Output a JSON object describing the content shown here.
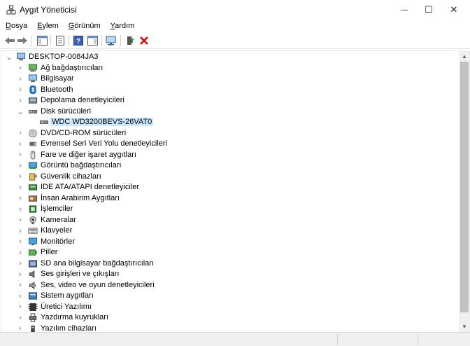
{
  "window": {
    "title": "Aygıt Yöneticisi",
    "minimize_glyph": "—",
    "maximize_glyph": "☐",
    "close_glyph": "✕"
  },
  "menu": [
    {
      "u": "D",
      "rest": "osya"
    },
    {
      "u": "E",
      "rest": "ylem"
    },
    {
      "u": "G",
      "rest": "örünüm"
    },
    {
      "u": "Y",
      "rest": "ardım"
    }
  ],
  "toolbar": {
    "buttons": [
      "back-arrow-icon",
      "forward-arrow-icon",
      "show-hide-console-tree-icon",
      "properties-icon",
      "help-icon",
      "action-pane-icon",
      "scan-hardware-icon",
      "update-driver-icon",
      "uninstall-icon"
    ]
  },
  "tree": {
    "root": "DESKTOP-0084JA3",
    "items": [
      {
        "label": "Ağ bağdaştırıcıları",
        "icon": "network-adapter-icon",
        "expanded": false
      },
      {
        "label": "Bilgisayar",
        "icon": "computer-icon",
        "expanded": false
      },
      {
        "label": "Bluetooth",
        "icon": "bluetooth-icon",
        "expanded": false
      },
      {
        "label": "Depolama denetleyicileri",
        "icon": "storage-controller-icon",
        "expanded": false
      },
      {
        "label": "Disk sürücüleri",
        "icon": "disk-drive-icon",
        "expanded": true
      },
      {
        "label": "WDC WD3200BEVS-26VAT0",
        "icon": "disk-drive-icon",
        "child": true,
        "selected": true
      },
      {
        "label": "DVD/CD-ROM sürücüleri",
        "icon": "dvd-drive-icon",
        "expanded": false
      },
      {
        "label": "Evrensel Seri Veri Yolu denetleyicileri",
        "icon": "usb-icon",
        "expanded": false
      },
      {
        "label": "Fare ve diğer işaret aygıtları",
        "icon": "mouse-icon",
        "expanded": false
      },
      {
        "label": "Görüntü bağdaştırıcıları",
        "icon": "display-adapter-icon",
        "expanded": false
      },
      {
        "label": "Güvenlik cihazları",
        "icon": "security-device-icon",
        "expanded": false
      },
      {
        "label": "IDE ATA/ATAPI denetleyiciler",
        "icon": "ide-controller-icon",
        "expanded": false
      },
      {
        "label": "İnsan Arabirim Aygıtları",
        "icon": "hid-icon",
        "expanded": false
      },
      {
        "label": "İşlemciler",
        "icon": "processor-icon",
        "expanded": false
      },
      {
        "label": "Kameralar",
        "icon": "camera-icon",
        "expanded": false
      },
      {
        "label": "Klavyeler",
        "icon": "keyboard-icon",
        "expanded": false
      },
      {
        "label": "Monitörler",
        "icon": "monitor-icon",
        "expanded": false
      },
      {
        "label": "Piller",
        "icon": "battery-icon",
        "expanded": false
      },
      {
        "label": "SD ana bilgisayar bağdaştırıcıları",
        "icon": "sd-host-icon",
        "expanded": false
      },
      {
        "label": "Ses girişleri ve çıkışları",
        "icon": "speaker-icon",
        "expanded": false
      },
      {
        "label": "Ses, video ve oyun denetleyicileri",
        "icon": "sound-controller-icon",
        "expanded": false
      },
      {
        "label": "Sistem aygıtları",
        "icon": "system-device-icon",
        "expanded": false
      },
      {
        "label": "Üretici Yazılımı",
        "icon": "firmware-icon",
        "expanded": false
      },
      {
        "label": "Yazdırma kuyrukları",
        "icon": "print-queue-icon",
        "expanded": false
      },
      {
        "label": "Yazılım cihazları",
        "icon": "software-device-icon",
        "expanded": false
      }
    ]
  },
  "colors": {
    "selection": "#cce8ff",
    "accent_green": "#2e9e2e",
    "close_red": "#d40000"
  }
}
